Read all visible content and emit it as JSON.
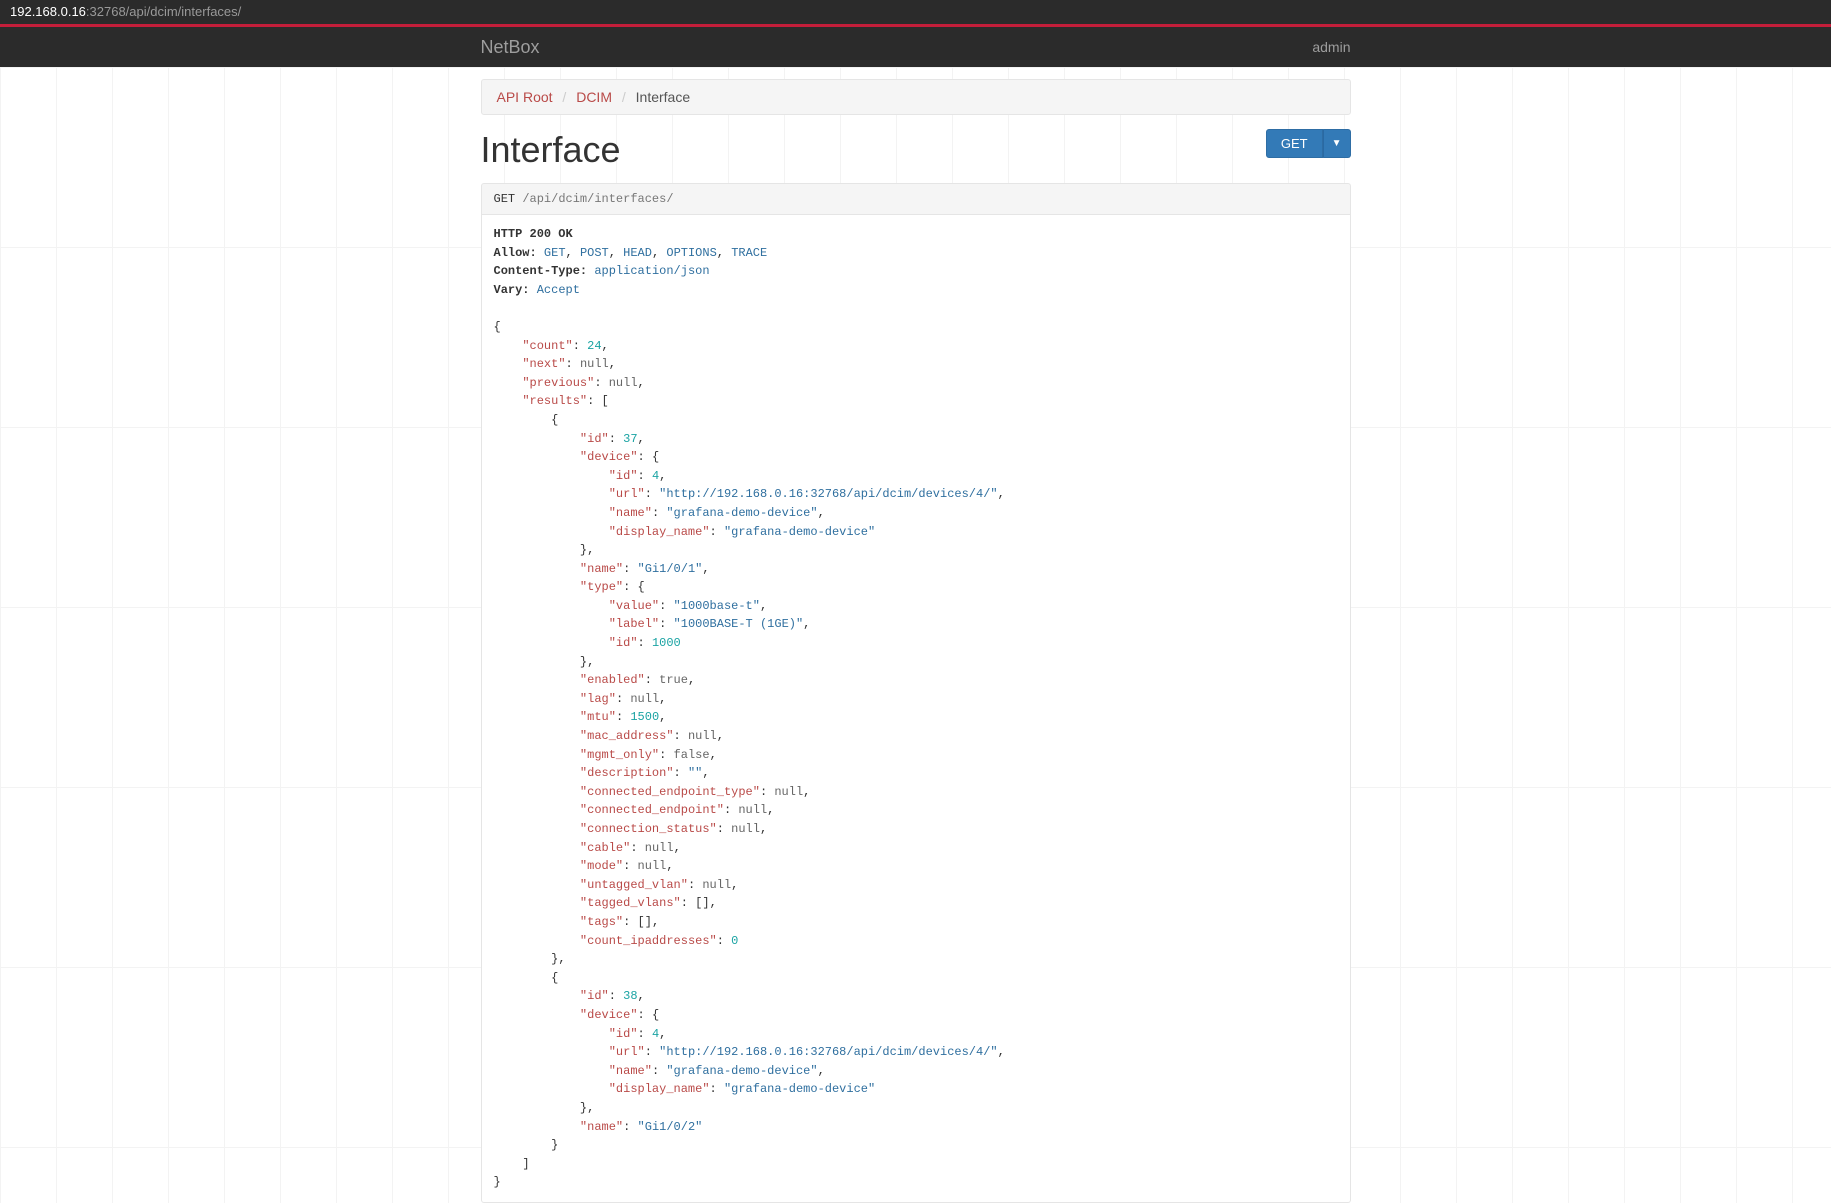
{
  "url_bar": {
    "ip": "192.168.0.16",
    "rest": ":32768/api/dcim/interfaces/"
  },
  "navbar": {
    "brand": "NetBox",
    "user": "admin"
  },
  "breadcrumb": {
    "root": "API Root",
    "mid": "DCIM",
    "leaf": "Interface",
    "sep": "/"
  },
  "page": {
    "title": "Interface",
    "get_btn": "GET"
  },
  "request": {
    "method": "GET",
    "path": "/api/dcim/interfaces/"
  },
  "headers": {
    "status": "HTTP 200 OK",
    "allow_label": "Allow:",
    "allow": [
      "GET",
      "POST",
      "HEAD",
      "OPTIONS",
      "TRACE"
    ],
    "ctype_label": "Content-Type:",
    "ctype": "application/json",
    "vary_label": "Vary:",
    "vary": "Accept"
  },
  "json_body": {
    "count": 24,
    "next": null,
    "previous": null,
    "results": [
      {
        "id": 37,
        "device": {
          "id": 4,
          "url": "http://192.168.0.16:32768/api/dcim/devices/4/",
          "name": "grafana-demo-device",
          "display_name": "grafana-demo-device"
        },
        "name": "Gi1/0/1",
        "type": {
          "value": "1000base-t",
          "label": "1000BASE-T (1GE)",
          "id": 1000
        },
        "enabled": true,
        "lag": null,
        "mtu": 1500,
        "mac_address": null,
        "mgmt_only": false,
        "description": "",
        "connected_endpoint_type": null,
        "connected_endpoint": null,
        "connection_status": null,
        "cable": null,
        "mode": null,
        "untagged_vlan": null,
        "tagged_vlans": [],
        "tags": [],
        "count_ipaddresses": 0
      },
      {
        "id": 38,
        "device": {
          "id": 4,
          "url": "http://192.168.0.16:32768/api/dcim/devices/4/",
          "name": "grafana-demo-device",
          "display_name": "grafana-demo-device"
        },
        "name": "Gi1/0/2"
      }
    ]
  }
}
